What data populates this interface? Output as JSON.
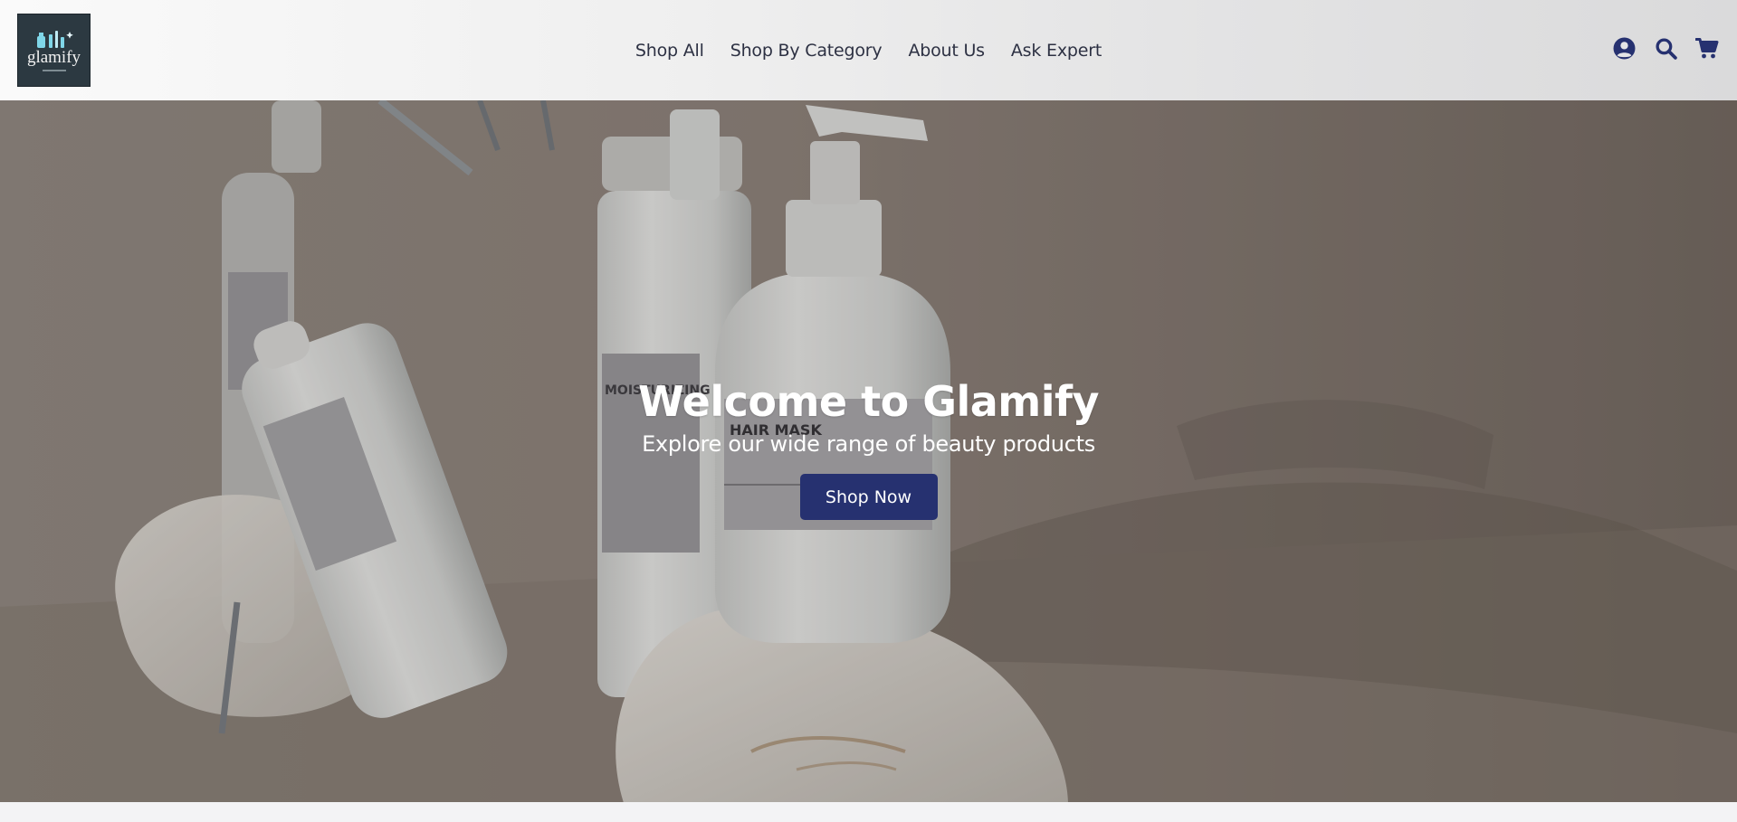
{
  "brand": {
    "logo_text": "glamify",
    "logo_colors": {
      "background": "#2c3941",
      "accent": "#7fd6e8"
    }
  },
  "nav": {
    "items": [
      {
        "label": "Shop All"
      },
      {
        "label": "Shop By Category"
      },
      {
        "label": "About Us"
      },
      {
        "label": "Ask Expert"
      }
    ]
  },
  "header_icons": [
    "user-circle-icon",
    "search-icon",
    "cart-icon"
  ],
  "hero": {
    "title": "Welcome to Glamify",
    "subtitle": "Explore our wide range of beauty products",
    "cta_label": "Shop Now",
    "product_label": "HAIR MASK",
    "bottle_label": "MOISTURIZING CONDITIONER"
  },
  "colors": {
    "primary": "#263170",
    "nav_text": "#2d3143",
    "icon": "#263170"
  }
}
